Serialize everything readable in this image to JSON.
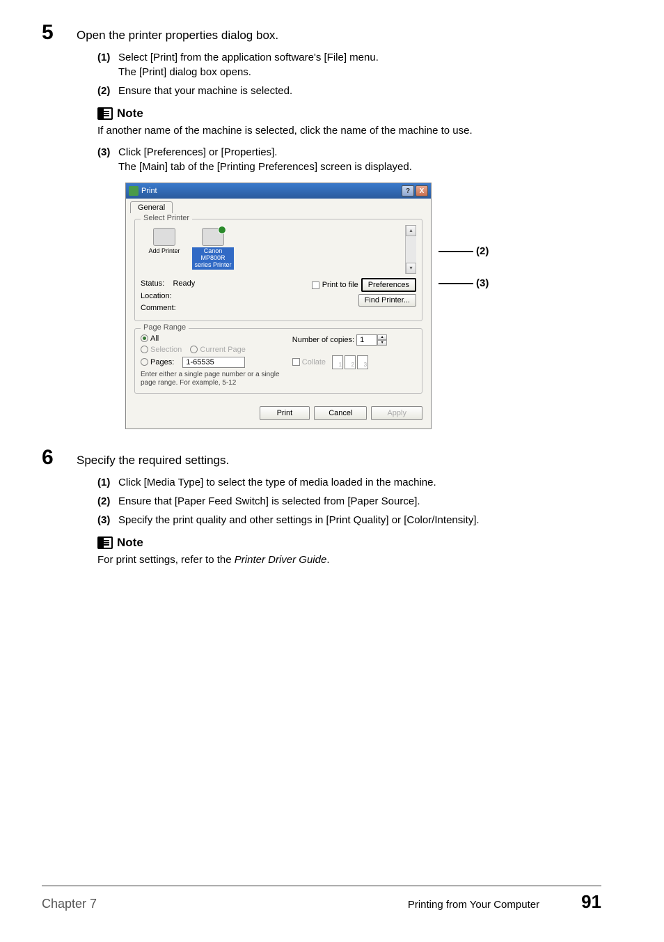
{
  "step5": {
    "num": "5",
    "title": "Open the printer properties dialog box.",
    "items": [
      {
        "num": "(1)",
        "text": "Select [Print] from the application software's [File] menu.\nThe [Print] dialog box opens."
      },
      {
        "num": "(2)",
        "text": "Ensure that your machine is selected."
      }
    ],
    "note": {
      "label": "Note",
      "text": "If another name of the machine is selected, click the name of the machine to use."
    },
    "item3": {
      "num": "(3)",
      "text": "Click [Preferences] or [Properties].\nThe [Main] tab of the [Printing Preferences] screen is displayed."
    }
  },
  "dialog": {
    "title": "Print",
    "help": "?",
    "close": "X",
    "tab_general": "General",
    "select_printer_label": "Select Printer",
    "add_printer": "Add Printer",
    "printer_name": "Canon MP800R series Printer",
    "status_label": "Status:",
    "status_value": "Ready",
    "location_label": "Location:",
    "comment_label": "Comment:",
    "print_to_file": "Print to file",
    "preferences_btn": "Preferences",
    "find_printer_btn": "Find Printer...",
    "page_range_label": "Page Range",
    "all": "All",
    "selection": "Selection",
    "current_page": "Current Page",
    "pages": "Pages:",
    "pages_value": "1-65535",
    "pages_hint": "Enter either a single page number or a single page range.  For example, 5-12",
    "num_copies_label": "Number of copies:",
    "num_copies_value": "1",
    "collate": "Collate",
    "collate_pages": [
      "1",
      "2",
      "3"
    ],
    "print_btn": "Print",
    "cancel_btn": "Cancel",
    "apply_btn": "Apply"
  },
  "callouts": {
    "c2": "(2)",
    "c3": "(3)"
  },
  "step6": {
    "num": "6",
    "title": "Specify the required settings.",
    "items": [
      {
        "num": "(1)",
        "text": "Click [Media Type] to select the type of media loaded in the machine."
      },
      {
        "num": "(2)",
        "text": "Ensure that [Paper Feed Switch] is selected from [Paper Source]."
      },
      {
        "num": "(3)",
        "text": "Specify the print quality and other settings in [Print Quality] or [Color/Intensity]."
      }
    ],
    "note": {
      "label": "Note",
      "text_before": "For print settings, refer to the ",
      "text_italic": "Printer Driver Guide",
      "text_after": "."
    }
  },
  "footer": {
    "chapter": "Chapter 7",
    "section": "Printing from Your Computer",
    "page": "91"
  }
}
